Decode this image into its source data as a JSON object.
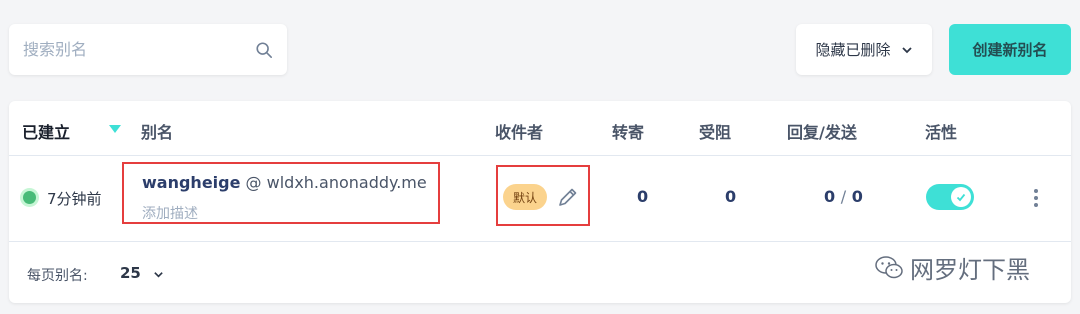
{
  "search": {
    "placeholder": "搜索别名"
  },
  "filter": {
    "label": "隐藏已删除"
  },
  "create_button": {
    "label": "创建新别名"
  },
  "table": {
    "headers": {
      "created": "已建立",
      "alias": "别名",
      "recipients": "收件者",
      "forwarded": "转寄",
      "blocked": "受阻",
      "replies_sent": "回复/发送",
      "active": "活性"
    },
    "rows": [
      {
        "created": "7分钟前",
        "alias_local": "wangheige",
        "alias_domain": "@ wldxh.anonaddy.me",
        "description": "添加描述",
        "recipient_badge": "默认",
        "forwarded": "0",
        "blocked": "0",
        "replies": "0",
        "sent": "0",
        "separator": "/",
        "active": true
      }
    ]
  },
  "pagination": {
    "label": "每页别名:",
    "value": "25"
  },
  "watermark": {
    "text": "网罗灯下黑"
  },
  "colors": {
    "accent": "#3ee0d6",
    "highlight": "#e53e3e",
    "badge": "#fbd38d",
    "status_active": "#48bb78"
  }
}
